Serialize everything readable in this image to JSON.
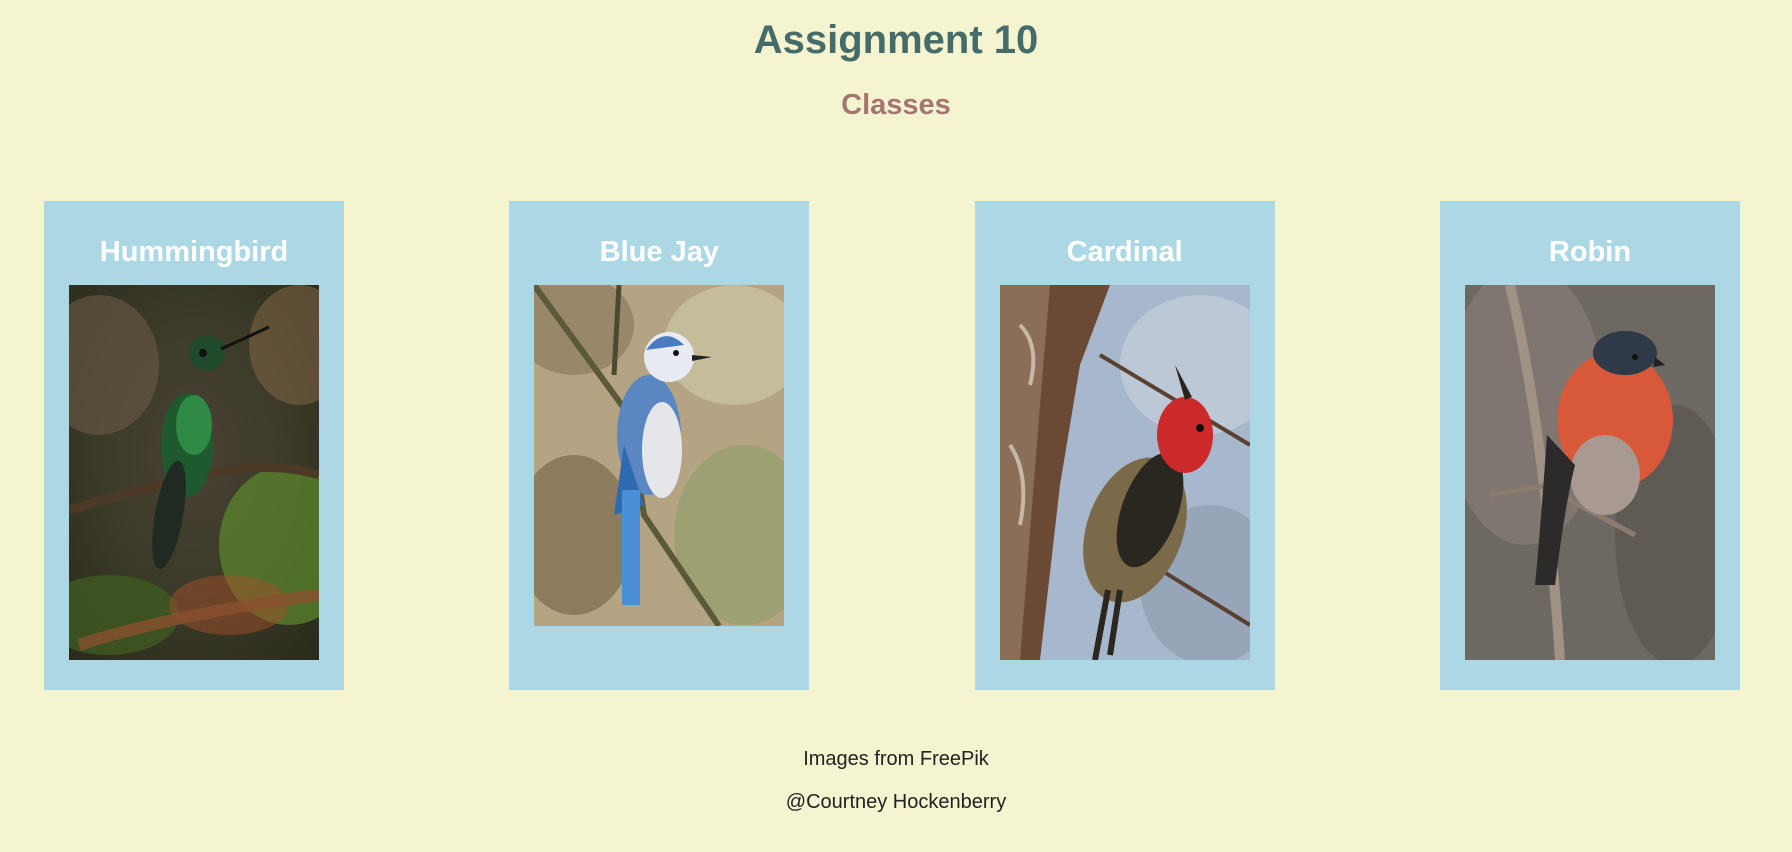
{
  "header": {
    "title": "Assignment 10",
    "subtitle": "Classes"
  },
  "cards": [
    {
      "title": "Hummingbird"
    },
    {
      "title": "Blue Jay"
    },
    {
      "title": "Cardinal"
    },
    {
      "title": "Robin"
    }
  ],
  "footer": {
    "credit": "Images from FreePik",
    "author": "@Courtney Hockenberry"
  },
  "colors": {
    "background": "#f4f4d0",
    "title": "#466c6a",
    "subtitle": "#a57670",
    "card": "#acd8e6",
    "card_title": "#ffffff"
  }
}
